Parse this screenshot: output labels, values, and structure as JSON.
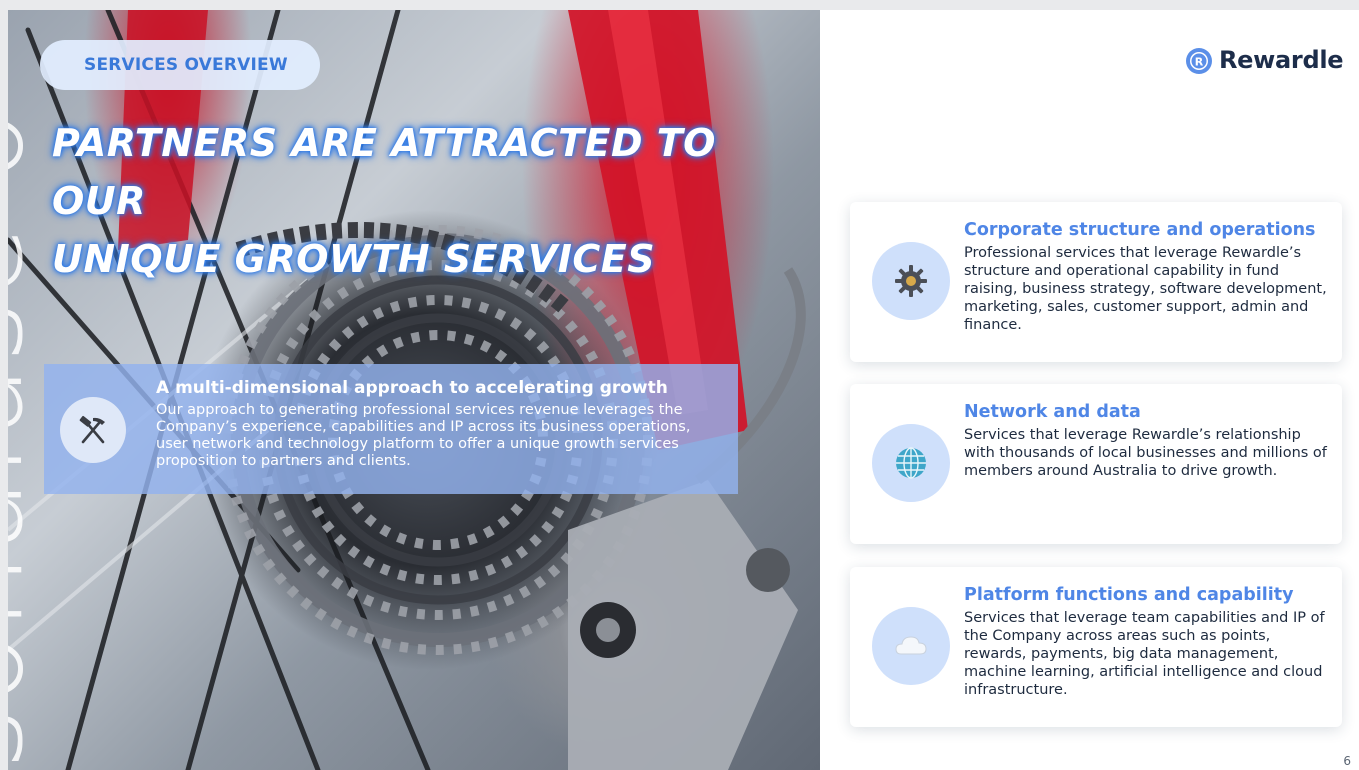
{
  "watermark": "sonaluse o",
  "section_pill": "SERVICES OVERVIEW",
  "headline": {
    "line1": "PARTNERS ARE ATTRACTED TO OUR",
    "line2": "UNIQUE GROWTH SERVICES"
  },
  "approach": {
    "icon": "hammer-pick-icon",
    "title": "A multi-dimensional approach to accelerating growth",
    "body": "Our approach to generating professional services revenue leverages the Company’s  experience, capabilities and IP across its business operations, user network and technology platform to offer a unique growth services proposition to partners and clients."
  },
  "logo": {
    "text": "Rewardle",
    "badge_letter": "R",
    "badge_color": "#5b8fe8"
  },
  "cards": [
    {
      "icon": "gear-icon",
      "title": "Corporate structure and operations",
      "body": "Professional services that leverage Rewardle’s structure and operational capability in fund raising, business strategy, software development, marketing, sales, customer support, admin and finance."
    },
    {
      "icon": "globe-icon",
      "title": "Network and data",
      "body": "Services that leverage Rewardle’s relationship with thousands of local businesses and millions of members around Australia to drive growth."
    },
    {
      "icon": "cloud-icon",
      "title": "Platform functions and capability",
      "body": "Services that leverage team capabilities and IP of the Company across areas such as points, rewards, payments, big data management, machine learning, artificial intelligence and cloud infrastructure."
    }
  ],
  "page_number": "6",
  "colors": {
    "accent_blue": "#4f86e6",
    "pill_text": "#3a79d9",
    "headline_glow": "#2f7ae6",
    "approach_panel": "#92b2ee",
    "icon_circle": "#cfe0fb",
    "body_text": "#1e2b3f"
  }
}
